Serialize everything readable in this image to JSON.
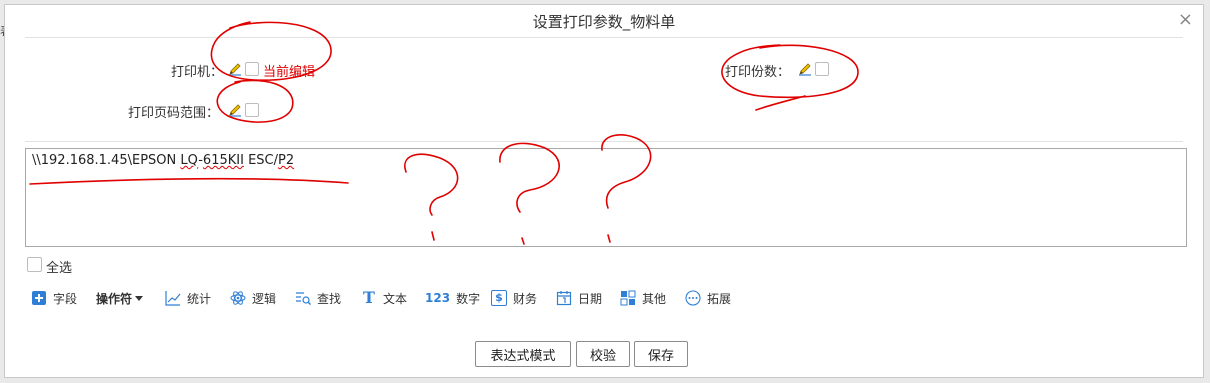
{
  "background": {
    "left_fragment": "表"
  },
  "dialog": {
    "title": "设置打印参数_物料单",
    "close_glyph": "×"
  },
  "fields": {
    "printer_label": "打印机：",
    "printer_status": "当前编辑",
    "copies_label": "打印份数：",
    "page_range_label": "打印页码范围："
  },
  "editor": {
    "content_prefix": "\\\\192.168.1.45\\EPSON ",
    "content_underlined_1": "LQ",
    "content_middle": "-",
    "content_underlined_2": "615KII",
    "content_space": " ",
    "content_plain_2": "ESC/",
    "content_underlined_3": "P2"
  },
  "select_all_label": "全选",
  "toolbar": {
    "items": [
      {
        "label": "字段",
        "icon": "plus-square-icon"
      },
      {
        "label": "操作符",
        "icon": "dropdown-caret-icon"
      },
      {
        "label": "统计",
        "icon": "line-chart-icon"
      },
      {
        "label": "逻辑",
        "icon": "atom-icon"
      },
      {
        "label": "查找",
        "icon": "search-list-icon"
      },
      {
        "label": "文本",
        "icon": "text-t-icon"
      },
      {
        "label": "数字",
        "icon": "number-123-icon"
      },
      {
        "label": "财务",
        "icon": "dollar-icon"
      },
      {
        "label": "日期",
        "icon": "calendar-icon"
      },
      {
        "label": "其他",
        "icon": "grid-icon"
      },
      {
        "label": "拓展",
        "icon": "ellipsis-circle-icon"
      }
    ],
    "number_glyph": "123",
    "text_glyph": "T",
    "dollar_glyph": "$"
  },
  "buttons": {
    "expression_mode": "表达式模式",
    "validate": "校验",
    "save": "保存"
  },
  "colors": {
    "accent_blue": "#2f7fd6",
    "annotation_red": "#e00000",
    "pencil_yellow": "#f2c200"
  }
}
